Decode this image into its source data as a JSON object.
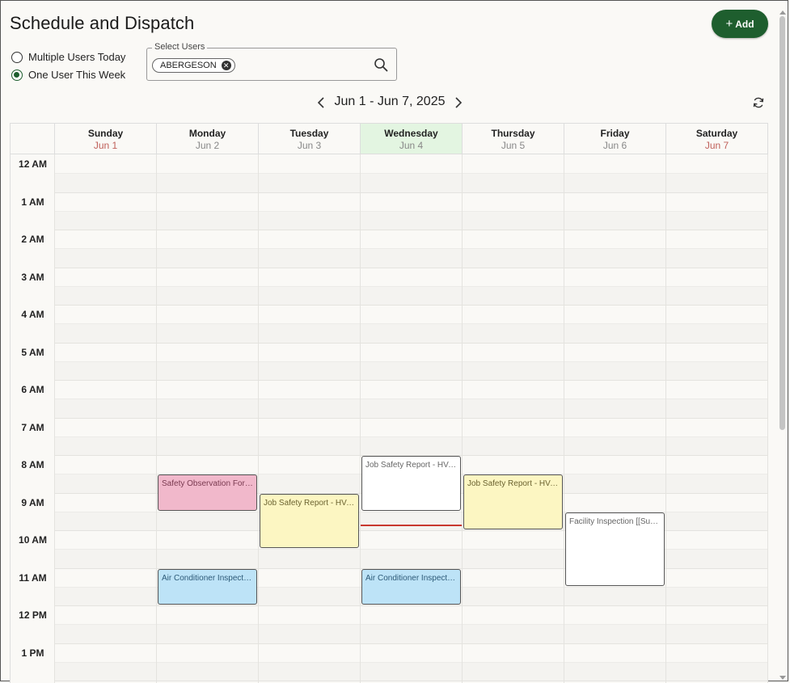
{
  "header": {
    "title": "Schedule and Dispatch",
    "add_label": "Add"
  },
  "view_options": [
    {
      "label": "Multiple Users Today",
      "selected": false
    },
    {
      "label": "One User This Week",
      "selected": true
    }
  ],
  "user_select": {
    "label": "Select Users",
    "chips": [
      "ABERGESON"
    ]
  },
  "nav": {
    "range": "Jun 1 - Jun 7, 2025"
  },
  "days": [
    {
      "name": "Sunday",
      "date": "Jun 1",
      "weekend": true,
      "today": false
    },
    {
      "name": "Monday",
      "date": "Jun 2",
      "weekend": false,
      "today": false
    },
    {
      "name": "Tuesday",
      "date": "Jun 3",
      "weekend": false,
      "today": false
    },
    {
      "name": "Wednesday",
      "date": "Jun 4",
      "weekend": false,
      "today": true
    },
    {
      "name": "Thursday",
      "date": "Jun 5",
      "weekend": false,
      "today": false
    },
    {
      "name": "Friday",
      "date": "Jun 6",
      "weekend": false,
      "today": false
    },
    {
      "name": "Saturday",
      "date": "Jun 7",
      "weekend": true,
      "today": false
    }
  ],
  "hours": [
    "12 AM",
    "1 AM",
    "2 AM",
    "3 AM",
    "4 AM",
    "5 AM",
    "6 AM",
    "7 AM",
    "8 AM",
    "9 AM",
    "10 AM",
    "11 AM",
    "12 PM",
    "1 PM"
  ],
  "events": [
    {
      "title": "Safety Observation Form - ...",
      "day": 1,
      "start": 8.5,
      "end": 9.5,
      "color": "#f1b8cb",
      "text_color": "#7a3a50"
    },
    {
      "title": "Job Safety Report - HVAC",
      "day": 2,
      "start": 9.0,
      "end": 10.5,
      "color": "#fcf6c2",
      "text_color": "#6b6330"
    },
    {
      "title": "Job Safety Report - HVAC",
      "day": 3,
      "start": 8.0,
      "end": 9.5,
      "color": "#ffffff",
      "text_color": "#666666"
    },
    {
      "title": "Job Safety Report - HVAC",
      "day": 4,
      "start": 8.5,
      "end": 10.0,
      "color": "#fcf6c2",
      "text_color": "#6b6330"
    },
    {
      "title": "Facility Inspection [[Surve...",
      "day": 5,
      "start": 9.5,
      "end": 11.5,
      "color": "#ffffff",
      "text_color": "#666666"
    },
    {
      "title": "Air Conditioner Inspection",
      "day": 1,
      "start": 11.0,
      "end": 12.0,
      "color": "#bde3f7",
      "text_color": "#2d5a78"
    },
    {
      "title": "Air Conditioner Inspection",
      "day": 3,
      "start": 11.0,
      "end": 12.0,
      "color": "#bde3f7",
      "text_color": "#2d5a78"
    }
  ],
  "now_indicator": {
    "day": 3,
    "hour": 9.85,
    "color": "#c8382f"
  },
  "colors": {
    "brand": "#1e5e2e",
    "today_bg": "#e3f5e1",
    "weekend_text": "#c0605a"
  }
}
